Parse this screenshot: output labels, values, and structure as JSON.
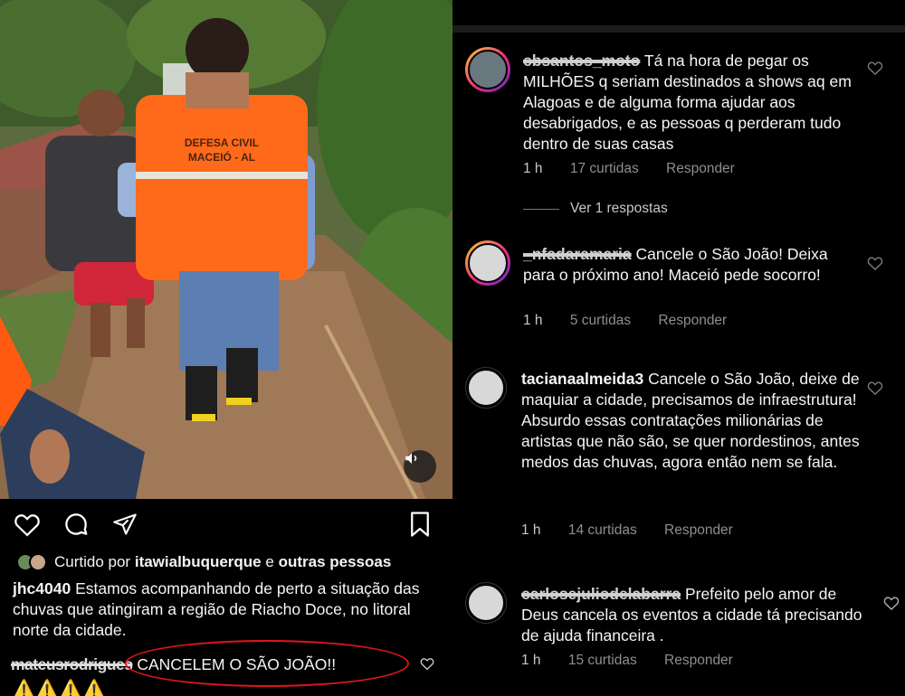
{
  "post": {
    "liked_by_prefix": "Curtido por",
    "liked_by_user": "itawialbuquerque",
    "liked_by_conj": "e",
    "liked_by_others": "outras pessoas",
    "caption_user": "jhc4040",
    "caption_text": "Estamos acompanhando de perto a situação das chuvas que atingiram a região de Riacho Doce, no litoral norte da cidade.",
    "first_comment_user": "mateusrodrigues",
    "first_comment_text": "CANCELEM O SÃO JOÃO!!",
    "warning_emojis": "⚠️⚠️⚠️⚠️",
    "vest_line1": "DEFESA CIVIL",
    "vest_line2": "MACEIÓ - AL"
  },
  "comments": [
    {
      "user": "cbsantos_moto",
      "text": "Tá na hora de pegar os MILHÕES  q seriam destinados a shows aq em Alagoas e de alguma forma ajudar aos desabrigados, e as pessoas q perderam tudo dentro de suas casas",
      "time": "1 h",
      "likes": "17 curtidas",
      "reply": "Responder",
      "view_replies": "Ver 1 respostas"
    },
    {
      "user": "_nfadaramaria",
      "text": "Cancele o São João! Deixa para o próximo ano! Maceió pede socorro!",
      "time": "1 h",
      "likes": "5 curtidas",
      "reply": "Responder"
    },
    {
      "user": "tacianaalmeida3",
      "text": "Cancele o São João, deixe de maquiar a cidade, precisamos de infraestrutura! Absurdo essas contratações milionárias de artistas que não são, se quer nordestinos, antes medos das chuvas, agora então nem se fala.",
      "time": "1 h",
      "likes": "14 curtidas",
      "reply": "Responder"
    },
    {
      "user": "carlosejuliodelabarra",
      "text": "Prefeito pelo amor de Deus cancela os eventos a cidade tá precisando de ajuda financeira .",
      "time": "1 h",
      "likes": "15 curtidas",
      "reply": "Responder"
    }
  ],
  "colors": {
    "background": "#000000",
    "text": "#f5f5f5",
    "muted": "#8e8e8e",
    "highlight_circle": "#e0141e",
    "vest": "#ff6a1a"
  },
  "icons": [
    "heart-icon",
    "comment-icon",
    "share-icon",
    "bookmark-icon",
    "mute-icon"
  ]
}
